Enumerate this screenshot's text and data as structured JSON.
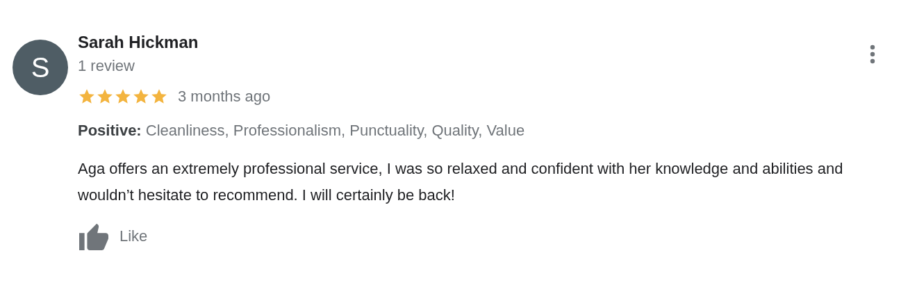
{
  "reviewer": {
    "initial": "S",
    "name": "Sarah Hickman",
    "review_count": "1 review"
  },
  "rating": {
    "stars": 5
  },
  "time": "3 months ago",
  "attributes": "**Positive:** Cleanliness, Professionalism, Punctuality, Quality, Value",
  "body": "Aga offers an extremely professional service, I was so relaxed and confident with her knowledge and abilities and wouldn’t hesitate to recommend. I will certainly be back!",
  "like": {
    "label": "Like"
  }
}
